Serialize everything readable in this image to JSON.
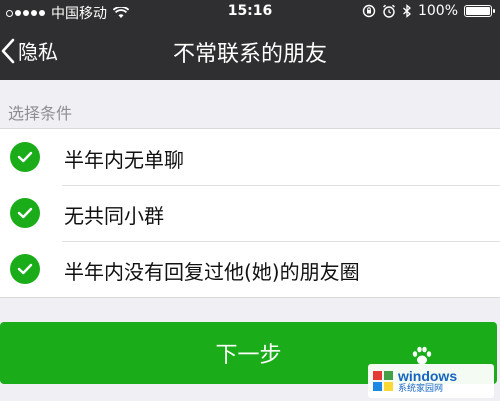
{
  "status_bar": {
    "carrier": "中国移动",
    "time": "15:16",
    "battery": "100%",
    "battery_level": 1.0
  },
  "nav": {
    "back_label": "隐私",
    "title": "不常联系的朋友"
  },
  "section": {
    "label": "选择条件"
  },
  "conditions": [
    {
      "label": "半年内无单聊",
      "checked": true
    },
    {
      "label": "无共同小群",
      "checked": true
    },
    {
      "label": "半年内没有回复过他(她)的朋友圈",
      "checked": true
    }
  ],
  "next_button": {
    "label": "下一步"
  },
  "watermark": {
    "main": "windows",
    "sub": "系统家园网"
  },
  "colors": {
    "accent": "#1aad19",
    "topbar": "#2f2f31",
    "background": "#efeff4"
  }
}
